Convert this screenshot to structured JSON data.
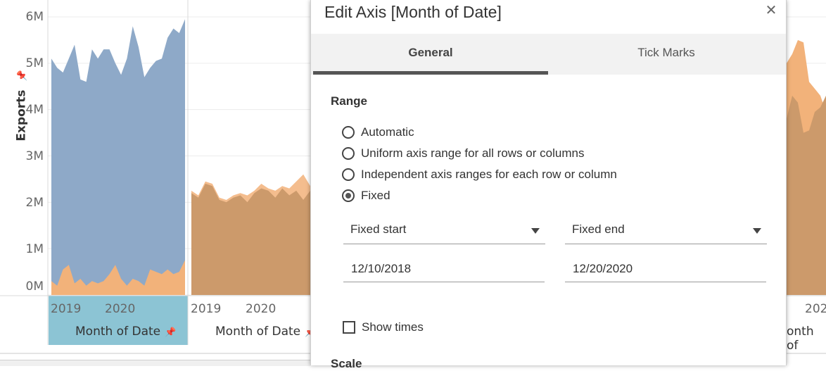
{
  "worksheet": {
    "y_axis": {
      "label": "Exports",
      "ticks": [
        "6M",
        "5M",
        "4M",
        "3M",
        "2M",
        "1M",
        "0M"
      ]
    },
    "panes": [
      {
        "x_ticks": [
          "2019",
          "2020"
        ],
        "title": "Month of Date",
        "selected": true
      },
      {
        "x_ticks": [
          "2019",
          "2020"
        ],
        "title": "Month of Date",
        "selected": false
      },
      {
        "x_ticks": [
          "202"
        ],
        "title": "onth of",
        "selected": false
      }
    ],
    "colors": {
      "blue": "#8ea9c8",
      "orange": "#f2b27a",
      "overlap": "#cc9a6b",
      "selected_header": "#8cc4d4"
    }
  },
  "chart_data": [
    {
      "type": "area",
      "xlabel": "Month of Date",
      "ylabel": "Exports",
      "ylim": [
        0,
        6000000
      ],
      "x_ticks": [
        "2019",
        "2020"
      ],
      "series": [
        {
          "values": [
            5100000,
            4900000,
            4800000,
            5100000,
            5400000,
            4650000,
            4600000,
            5300000,
            5100000,
            5300000,
            5300000,
            5000000,
            4750000,
            5100000,
            5800000,
            5350000,
            4700000,
            4900000,
            5050000,
            5100000,
            5550000,
            5750000,
            5650000,
            5950000
          ]
        },
        {
          "values": [
            300000,
            200000,
            550000,
            650000,
            250000,
            350000,
            200000,
            300000,
            250000,
            300000,
            450000,
            650000,
            350000,
            200000,
            350000,
            300000,
            200000,
            550000,
            500000,
            450000,
            550000,
            450000,
            500000,
            750000
          ]
        }
      ]
    },
    {
      "type": "area",
      "xlabel": "Month of Date",
      "ylabel": "Exports",
      "ylim": [
        0,
        6000000
      ],
      "x_ticks": [
        "2019",
        "2020"
      ],
      "series": [
        {
          "values": [
            2200000,
            2100000,
            2400000,
            2350000,
            2050000,
            2000000,
            2100000,
            2150000,
            2000000,
            2200000,
            2300000,
            2250000,
            2100000,
            2300000,
            2150000,
            2250000,
            2050000,
            2250000,
            2400000,
            2300000,
            2200000,
            2050000,
            1800000,
            2000000
          ]
        },
        {
          "values": [
            2250000,
            2150000,
            2450000,
            2400000,
            2100000,
            2050000,
            2150000,
            2200000,
            2150000,
            2250000,
            2400000,
            2300000,
            2250000,
            2350000,
            2300000,
            2450000,
            2600000,
            2350000,
            2100000,
            1900000,
            1850000,
            2100000,
            1850000,
            2150000
          ]
        }
      ]
    },
    {
      "type": "area",
      "xlabel": "Month of Date",
      "ylabel": "Exports",
      "ylim": [
        0,
        6000000
      ],
      "x_ticks": [
        "202"
      ],
      "series": [
        {
          "values": [
            5000000,
            5200000,
            5500000,
            5450000,
            4600000,
            4450000,
            4300000,
            3950000
          ]
        },
        {
          "values": [
            3800000,
            4300000,
            4150000,
            3500000,
            3550000,
            3950000,
            4050000,
            4300000
          ]
        }
      ]
    }
  ],
  "dialog": {
    "title": "Edit Axis [Month of Date]",
    "close_icon": "close-icon",
    "tabs": [
      {
        "label": "General",
        "active": true
      },
      {
        "label": "Tick Marks",
        "active": false
      }
    ],
    "range": {
      "heading": "Range",
      "options": [
        {
          "label": "Automatic",
          "selected": false
        },
        {
          "label": "Uniform axis range for all rows or columns",
          "selected": false
        },
        {
          "label": "Independent axis ranges for each row or column",
          "selected": false
        },
        {
          "label": "Fixed",
          "selected": true
        }
      ],
      "start_mode": "Fixed start",
      "end_mode": "Fixed end",
      "start_value": "12/10/2018",
      "end_value": "12/20/2020"
    },
    "show_times": {
      "label": "Show times",
      "checked": false
    },
    "scale_heading": "Scale"
  }
}
